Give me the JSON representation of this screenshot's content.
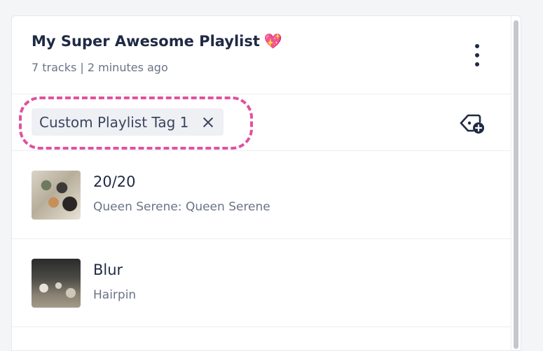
{
  "playlist": {
    "title": "My Super Awesome Playlist",
    "title_emoji": "💖",
    "subtitle": "7 tracks | 2 minutes ago",
    "menu_icon": "kebab-menu-icon"
  },
  "tags": [
    {
      "label": "Custom Playlist Tag 1",
      "remove_icon": "close-icon"
    }
  ],
  "add_tag_icon": "add-tag-icon",
  "highlight_color": "#e0529f",
  "tracks": [
    {
      "title": "20/20",
      "subtitle": "Queen Serene: Queen Serene"
    },
    {
      "title": "Blur",
      "subtitle": "Hairpin"
    }
  ]
}
